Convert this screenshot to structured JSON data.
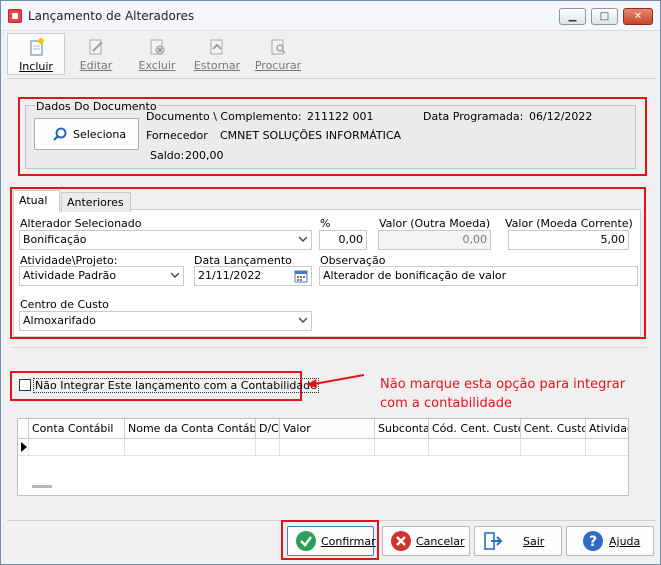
{
  "window": {
    "title": "Lançamento de Alteradores",
    "minimize": "▁",
    "maximize": "□",
    "close": "✕"
  },
  "toolbar": {
    "incluir": "Incluir",
    "editar": "Editar",
    "excluir": "Excluir",
    "estornar": "Estornar",
    "procurar": "Procurar"
  },
  "documento": {
    "group_title": "Dados Do Documento",
    "seleciona_label": "Seleciona",
    "doc_label": "Documento \\ Complemento:",
    "doc_value": "211122  001",
    "data_prog_label": "Data Programada:",
    "data_prog_value": "06/12/2022",
    "fornecedor_label": "Fornecedor",
    "fornecedor_value": "CMNET SOLUÇÕES INFORMÁTICA",
    "saldo_label": "Saldo:",
    "saldo_value": "200,00"
  },
  "tabs": [
    {
      "label": "Atual"
    },
    {
      "label": "Anteriores"
    }
  ],
  "form": {
    "alterador_label": "Alterador Selecionado",
    "alterador_value": "Bonificação",
    "percent_label": "%",
    "percent_value": "0,00",
    "valor_outra_label": "Valor (Outra Moeda)",
    "valor_outra_value": "0,00",
    "valor_corrente_label": "Valor (Moeda Corrente)",
    "valor_corrente_value": "5,00",
    "atividade_label": "Atividade\\Projeto:",
    "atividade_value": "Atividade Padrão",
    "data_lanc_label": "Data Lançamento",
    "data_lanc_value": "21/11/2022",
    "observacao_label": "Observação",
    "observacao_value": "Alterador de bonificação de valor",
    "centro_label": "Centro de Custo",
    "centro_value": "Almoxarifado"
  },
  "checkbox": {
    "label": "Não Integrar Este lançamento com a Contabilidade",
    "checked": false
  },
  "annotation": {
    "line1": "Não marque esta opção para integrar",
    "line2": "com a contabilidade"
  },
  "grid": {
    "columns": [
      "Conta Contábil",
      "Nome da Conta Contábil",
      "D/C",
      "Valor",
      "Subconta",
      "Cód. Cent. Custo",
      "Cent. Custo",
      "Atividad"
    ]
  },
  "buttons": {
    "confirmar": "Confirmar",
    "cancelar": "Cancelar",
    "sair": "Sair",
    "ajuda": "Ajuda"
  },
  "colors": {
    "highlight_red": "#e3131b",
    "confirm_green": "#2e9e5b",
    "cancel_red": "#d0332b",
    "help_blue": "#2f6bc4"
  }
}
